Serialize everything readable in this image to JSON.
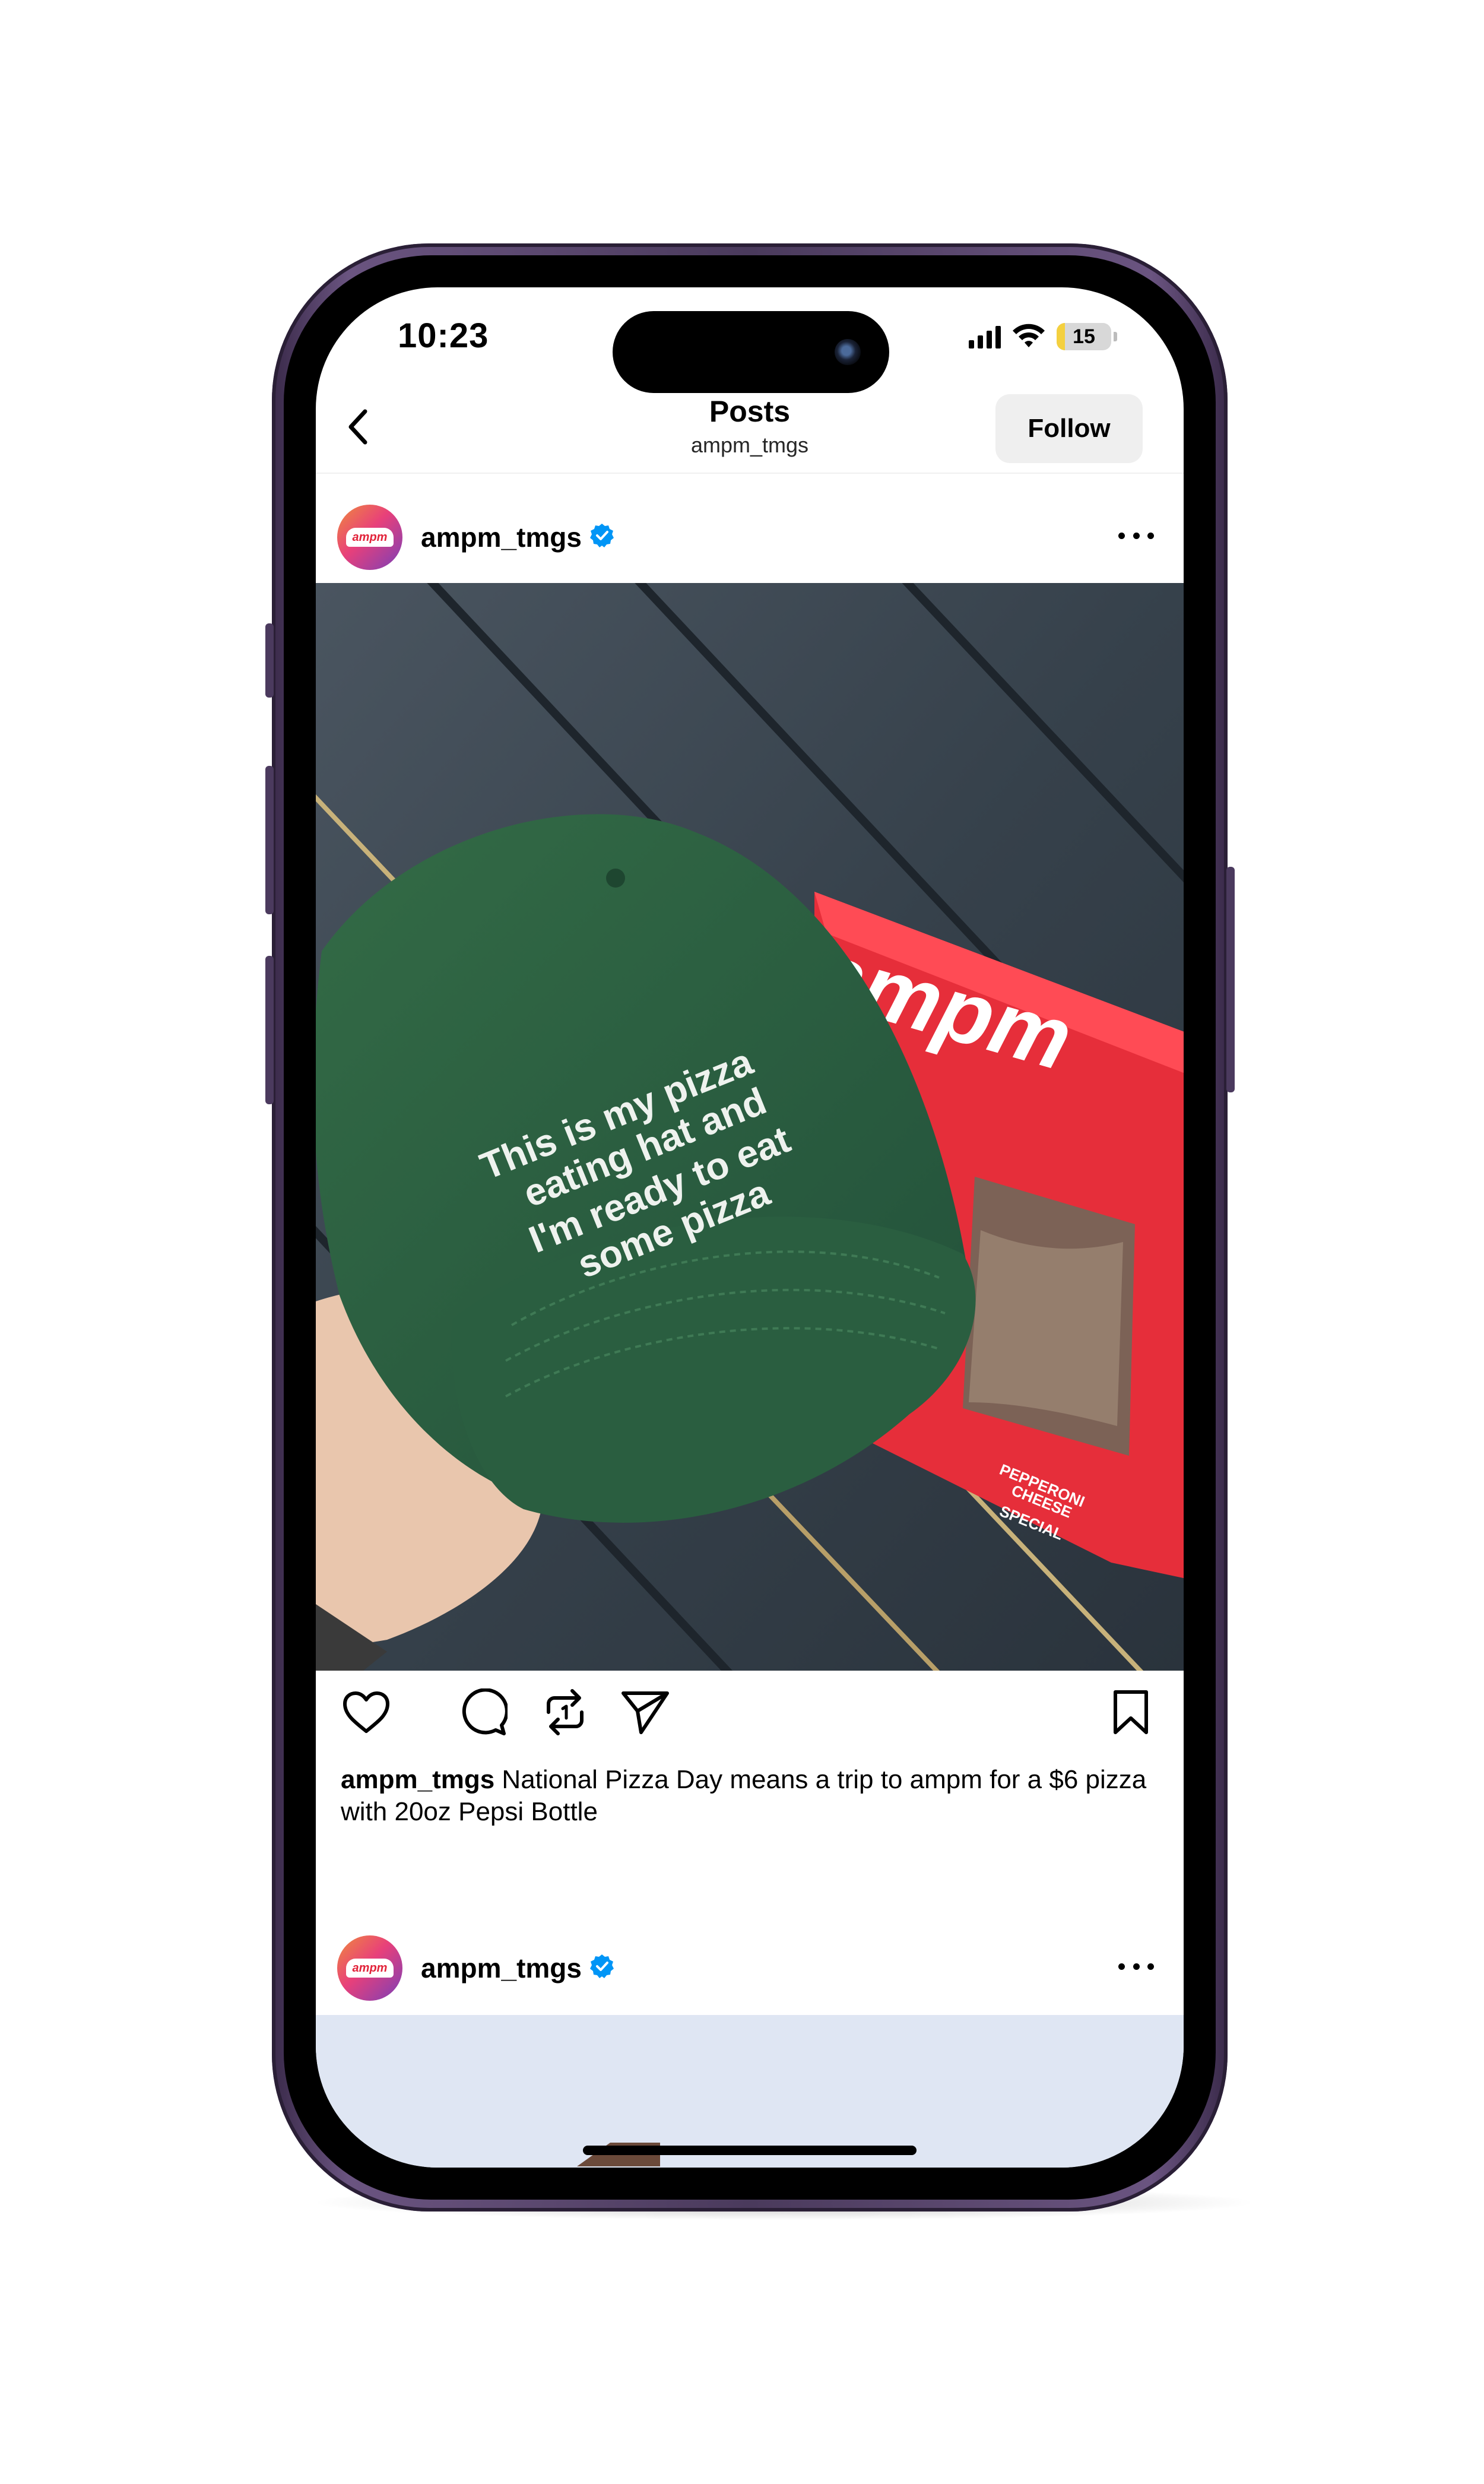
{
  "status_bar": {
    "time": "10:23",
    "battery_level": "15",
    "battery_fraction": 0.15,
    "signal_icon": "cellular-signal-icon",
    "wifi_icon": "wifi-icon"
  },
  "header": {
    "back_icon": "chevron-left-icon",
    "title": "Posts",
    "subtitle": "ampm_tmgs",
    "follow_label": "Follow"
  },
  "post": {
    "avatar_text": "ampm",
    "username": "ampm_tmgs",
    "verified_icon": "verified-badge-icon",
    "more_icon": "more-horizontal-icon",
    "photo": {
      "hat_text": "This is my pizza eating hat and I'm ready to eat some pizza",
      "box_brand": "ampm",
      "box_flavors": [
        "PEPPERONI",
        "CHEESE",
        "SPECIAL"
      ]
    },
    "actions": {
      "like_icon": "heart-icon",
      "comment_icon": "comment-icon",
      "repost_icon": "repost-icon",
      "share_icon": "send-icon",
      "save_icon": "bookmark-icon"
    },
    "caption_user": "ampm_tmgs",
    "caption_text": "National Pizza Day means a trip to ampm for a $6 pizza with 20oz Pepsi Bottle"
  },
  "next_post": {
    "avatar_text": "ampm",
    "username": "ampm_tmgs"
  },
  "colors": {
    "frame": "#4a3a5c",
    "verified": "#0095f6",
    "hat_green": "#2d5a3c",
    "box_red": "#e62e3a",
    "battery_yellow": "#f4d03f"
  }
}
